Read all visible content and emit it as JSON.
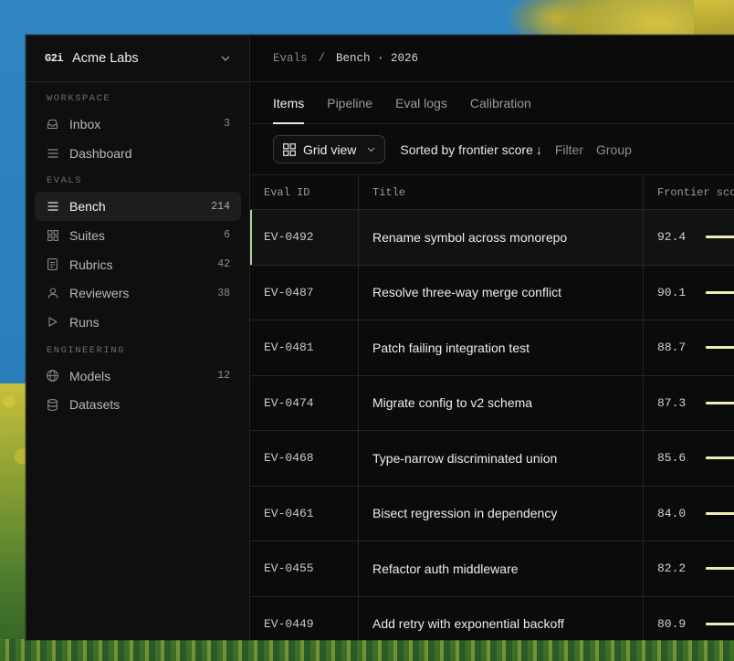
{
  "org": {
    "logo": "G2i",
    "name": "Acme Labs"
  },
  "sidebar": {
    "sections": [
      {
        "title": "WORKSPACE",
        "items": [
          {
            "label": "Inbox",
            "icon": "inbox-icon",
            "count": "3"
          },
          {
            "label": "Dashboard",
            "icon": "list-icon",
            "count": ""
          }
        ]
      },
      {
        "title": "EVALS",
        "items": [
          {
            "label": "Bench",
            "icon": "list-icon",
            "count": "214",
            "active": true
          },
          {
            "label": "Suites",
            "icon": "grid-icon",
            "count": "6"
          },
          {
            "label": "Rubrics",
            "icon": "document-icon",
            "count": "42"
          },
          {
            "label": "Reviewers",
            "icon": "person-icon",
            "count": "38"
          },
          {
            "label": "Runs",
            "icon": "play-icon",
            "count": ""
          }
        ]
      },
      {
        "title": "ENGINEERING",
        "items": [
          {
            "label": "Models",
            "icon": "globe-icon",
            "count": "12"
          },
          {
            "label": "Datasets",
            "icon": "database-icon",
            "count": ""
          }
        ]
      }
    ]
  },
  "breadcrumb": {
    "parent": "Evals",
    "separator": "/",
    "current": "Bench · 2026"
  },
  "tabs": [
    {
      "label": "Items",
      "active": true
    },
    {
      "label": "Pipeline"
    },
    {
      "label": "Eval logs"
    },
    {
      "label": "Calibration"
    }
  ],
  "toolbar": {
    "view_label": "Grid view",
    "sort_label": "Sorted by frontier score",
    "sort_arrow": "↓",
    "filter_label": "Filter",
    "group_label": "Group"
  },
  "table": {
    "columns": [
      "Eval ID",
      "Title",
      "Frontier score"
    ],
    "rows": [
      {
        "id": "EV-0492",
        "title": "Rename symbol across monorepo",
        "score": "92.4",
        "selected": true
      },
      {
        "id": "EV-0487",
        "title": "Resolve three-way merge conflict",
        "score": "90.1"
      },
      {
        "id": "EV-0481",
        "title": "Patch failing integration test",
        "score": "88.7"
      },
      {
        "id": "EV-0474",
        "title": "Migrate config to v2 schema",
        "score": "87.3"
      },
      {
        "id": "EV-0468",
        "title": "Type-narrow discriminated union",
        "score": "85.6"
      },
      {
        "id": "EV-0461",
        "title": "Bisect regression in dependency",
        "score": "84.0"
      },
      {
        "id": "EV-0455",
        "title": "Refactor auth middleware",
        "score": "82.2"
      },
      {
        "id": "EV-0449",
        "title": "Add retry with exponential backoff",
        "score": "80.9"
      }
    ]
  },
  "colors": {
    "selected_indicator": "#a9d79a",
    "score_bar": "#f2eeb3"
  }
}
